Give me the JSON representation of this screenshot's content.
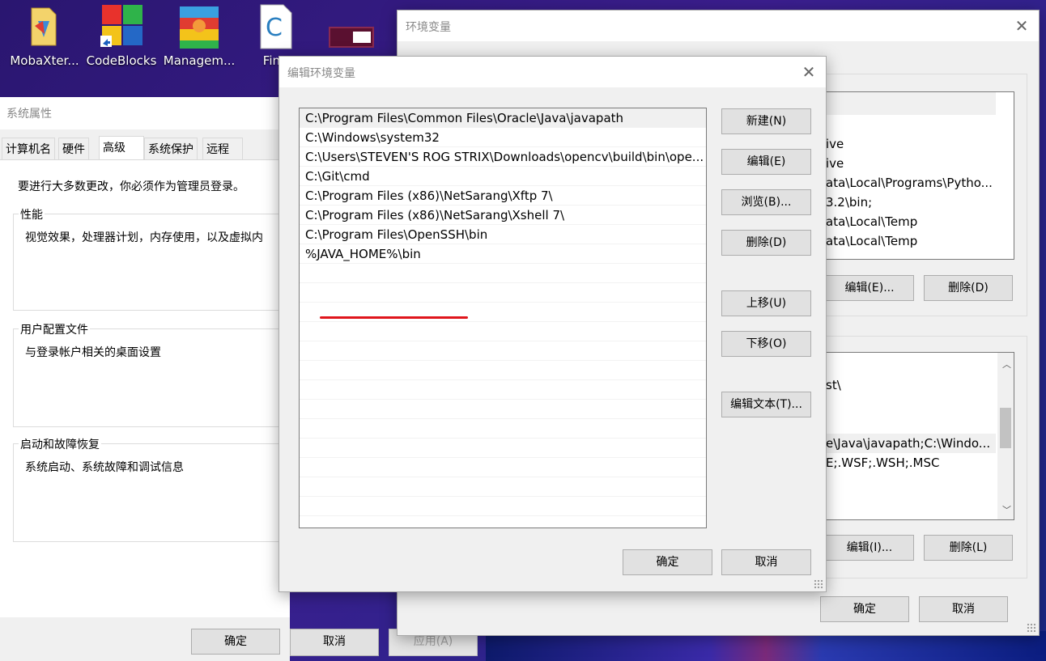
{
  "desktop": {
    "icons": [
      {
        "label": "MobaXter...",
        "icon": "mobaxterm-icon"
      },
      {
        "label": "CodeBlocks",
        "icon": "codeblocks-icon"
      },
      {
        "label": "Managem...",
        "icon": "winrar-icon"
      },
      {
        "label": "Fina",
        "icon": "c-file-icon"
      }
    ]
  },
  "system_properties": {
    "title": "系统属性",
    "tabs": [
      "计算机名",
      "硬件",
      "高级",
      "系统保护",
      "远程"
    ],
    "active_tab": "高级",
    "admin_notice": "要进行大多数更改，你必须作为管理员登录。",
    "groups": [
      {
        "label": "性能",
        "desc": "视觉效果，处理器计划，内存使用，以及虚拟内"
      },
      {
        "label": "用户配置文件",
        "desc": "与登录帐户相关的桌面设置"
      },
      {
        "label": "启动和故障恢复",
        "desc": "系统启动、系统故障和调试信息"
      }
    ],
    "buttons": {
      "ok": "确定",
      "cancel": "取消",
      "apply": "应用(A)"
    }
  },
  "env_vars": {
    "title": "环境变量",
    "user_list": [
      "ive",
      "ive",
      "ata\\Local\\Programs\\Pytho...",
      "3.2\\bin;",
      "ata\\Local\\Temp",
      "ata\\Local\\Temp"
    ],
    "user_buttons": {
      "edit": "编辑(E)...",
      "delete": "删除(D)"
    },
    "system_list": [
      "st\\",
      "",
      "",
      "e\\Java\\javapath;C:\\Windo...",
      "E;.WSF;.WSH;.MSC"
    ],
    "system_buttons": {
      "edit": "编辑(I)...",
      "delete": "删除(L)"
    },
    "buttons": {
      "ok": "确定",
      "cancel": "取消"
    }
  },
  "edit_dialog": {
    "title": "编辑环境变量",
    "paths": [
      "C:\\Program Files\\Common Files\\Oracle\\Java\\javapath",
      "C:\\Windows\\system32",
      "C:\\Users\\STEVEN'S ROG STRIX\\Downloads\\opencv\\build\\bin\\ope...",
      "C:\\Git\\cmd",
      "C:\\Program Files (x86)\\NetSarang\\Xftp 7\\",
      "C:\\Program Files (x86)\\NetSarang\\Xshell 7\\",
      "C:\\Program Files\\OpenSSH\\bin",
      "%JAVA_HOME%\\bin"
    ],
    "selected_index": 0,
    "highlight_color": "#e0151b",
    "side_buttons": {
      "new": "新建(N)",
      "edit": "编辑(E)",
      "browse": "浏览(B)...",
      "delete": "删除(D)",
      "move_up": "上移(U)",
      "move_down": "下移(O)",
      "edit_text": "编辑文本(T)..."
    },
    "buttons": {
      "ok": "确定",
      "cancel": "取消"
    }
  }
}
